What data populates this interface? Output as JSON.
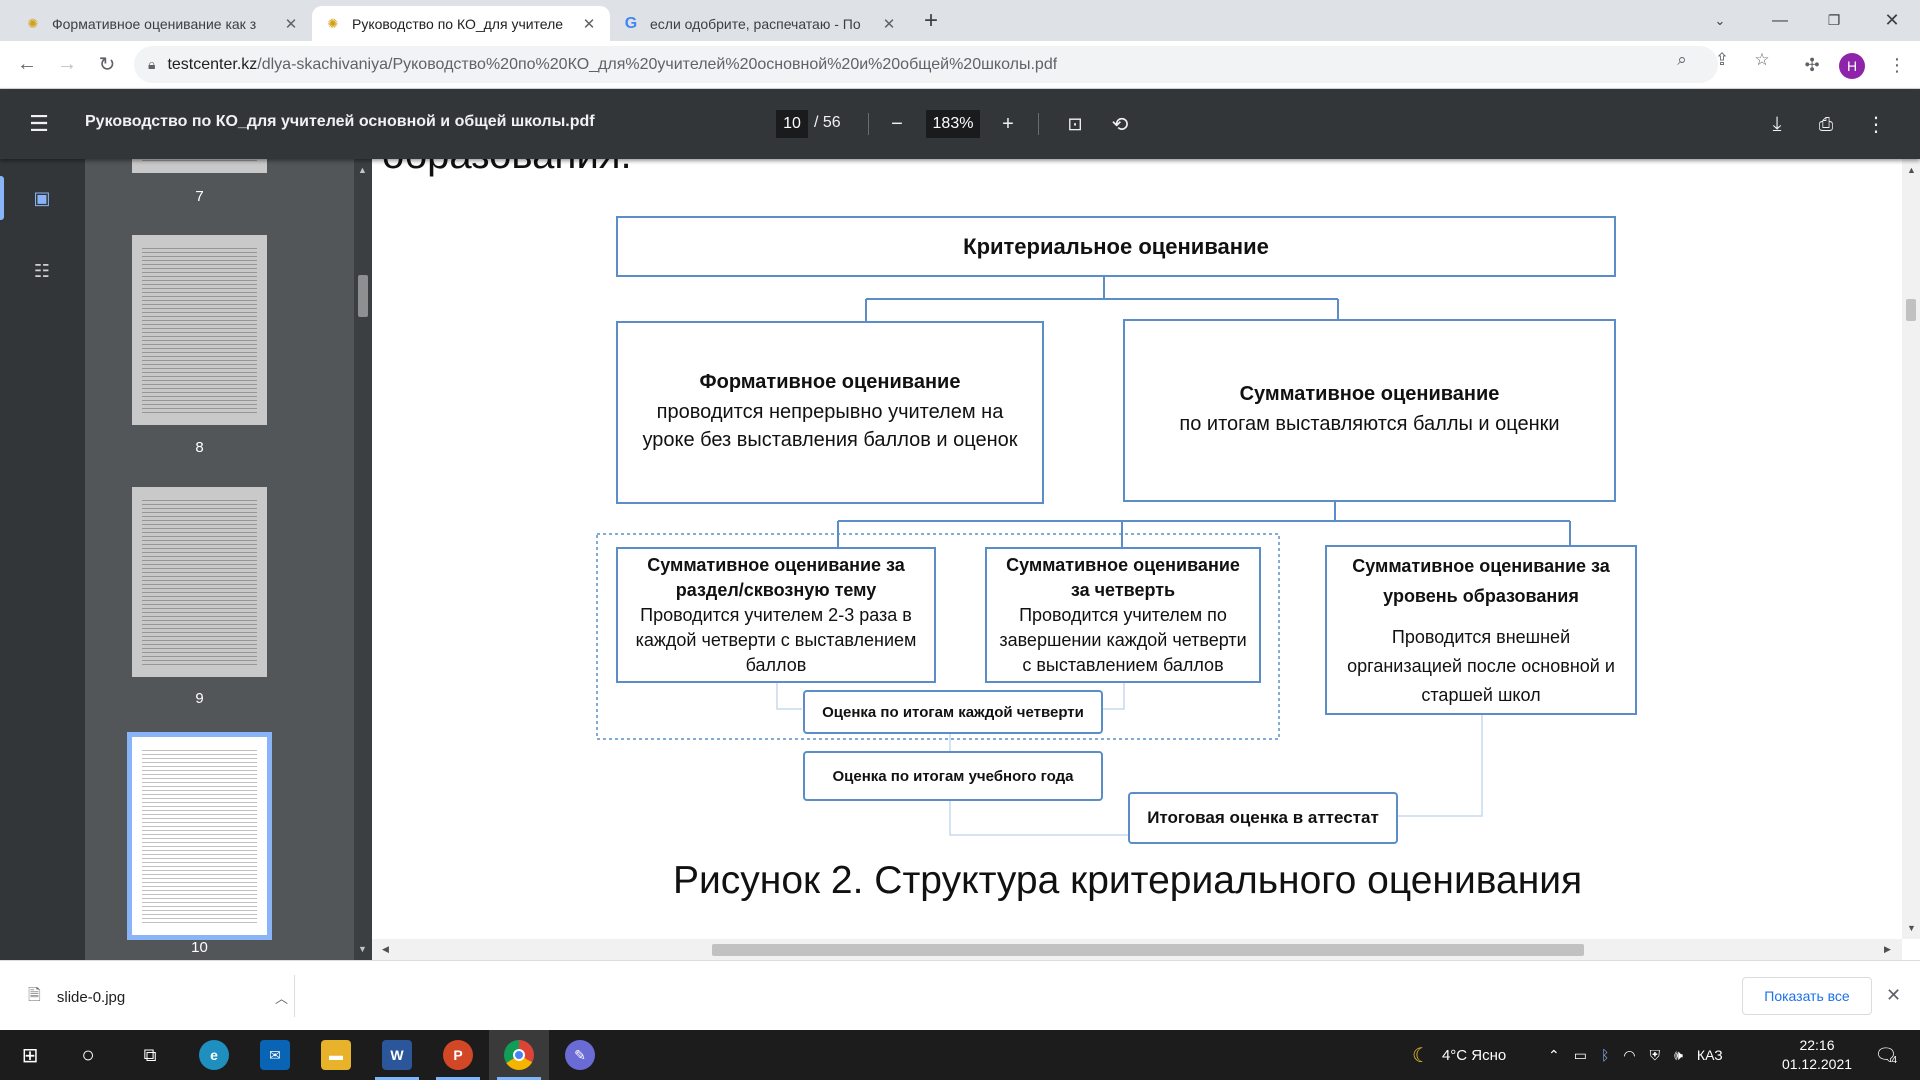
{
  "browser": {
    "tabs": [
      {
        "title": "Формативное оценивание как з",
        "favicon": "kazakh-emblem-icon",
        "active": false
      },
      {
        "title": "Руководство по КО_для учителе",
        "favicon": "kazakh-emblem-icon",
        "active": true
      },
      {
        "title": "если одобрите, распечатаю - По",
        "favicon": "google-icon",
        "active": false
      }
    ],
    "address": {
      "host": "testcenter.kz",
      "path": "/dlya-skachivaniya/Руководство%20по%20КО_для%20учителей%20основной%20и%20общей%20школы.pdf"
    },
    "profile_initial": "H"
  },
  "pdf": {
    "title": "Руководство по КО_для учителей основной и общей школы.pdf",
    "page_current": "10",
    "page_total": "/ 56",
    "zoom": "183%",
    "thumbnails": [
      {
        "num": "7",
        "active": false
      },
      {
        "num": "8",
        "active": false
      },
      {
        "num": "9",
        "active": false
      },
      {
        "num": "10",
        "active": true
      }
    ]
  },
  "document": {
    "heading_cut": "образования.",
    "diagram": {
      "root": "Критериальное оценивание",
      "formative": {
        "title": "Формативное оценивание",
        "desc": "проводится непрерывно учителем на уроке без выставления баллов и оценок"
      },
      "summative": {
        "title": "Суммативное оценивание",
        "desc": "по итогам выставляются баллы и оценки"
      },
      "sum_section": {
        "title": "Суммативное оценивание за раздел/сквозную тему",
        "desc": "Проводится учителем 2-3 раза в каждой четверти с выставлением баллов"
      },
      "sum_quarter": {
        "title": "Суммативное оценивание за четверть",
        "desc": "Проводится учителем по завершении каждой четверти с выставлением баллов"
      },
      "sum_level": {
        "title": "Суммативное оценивание  за уровень  образования",
        "desc": "Проводится внешней организацией после основной и старшей школ"
      },
      "quarter_grade": "Оценка по итогам каждой четверти",
      "year_grade": "Оценка по итогам учебного года",
      "final_grade": "Итоговая оценка в аттестат"
    },
    "caption": "Рисунок 2. Структура критериального оценивания"
  },
  "downloads": {
    "file": "slide-0.jpg",
    "show_all": "Показать все"
  },
  "taskbar": {
    "weather": "4°C  Ясно",
    "lang": "КАЗ",
    "time": "22:16",
    "date": "01.12.2021",
    "notifications": "4"
  }
}
